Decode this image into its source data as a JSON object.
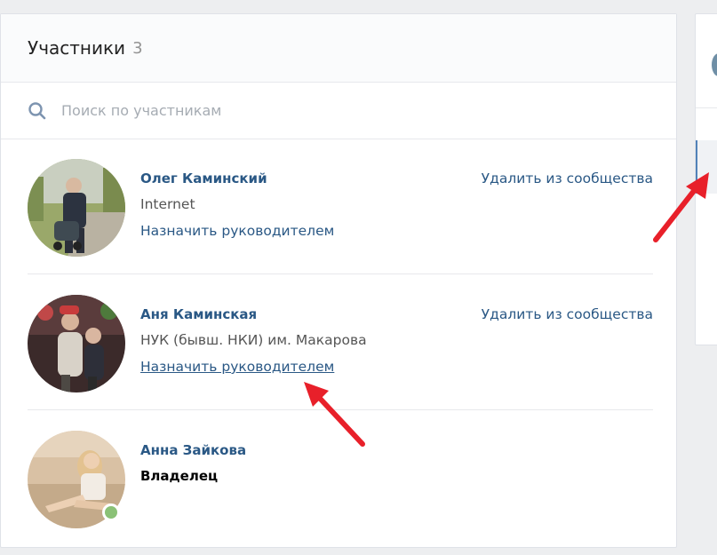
{
  "members_panel": {
    "title": "Участники",
    "count": "3",
    "search": {
      "placeholder": "Поиск по участникам",
      "value": "",
      "icon": "search-icon"
    },
    "members": [
      {
        "name": "Олег Каминский",
        "subtitle": "Internet",
        "action": "Назначить руководителем",
        "remove": "Удалить из сообщества",
        "online": false
      },
      {
        "name": "Аня Каминская",
        "subtitle": "НУК (бывш. НКИ) им. Макарова",
        "action": "Назначить руководителем",
        "remove": "Удалить из сообщества",
        "online": false
      },
      {
        "name": "Анна Зайкова",
        "role": "Владелец",
        "online": true
      }
    ]
  },
  "colors": {
    "link": "#2a5885",
    "background": "#edeef0",
    "online": "#8ac176",
    "annotation_arrow": "#e8202a"
  }
}
